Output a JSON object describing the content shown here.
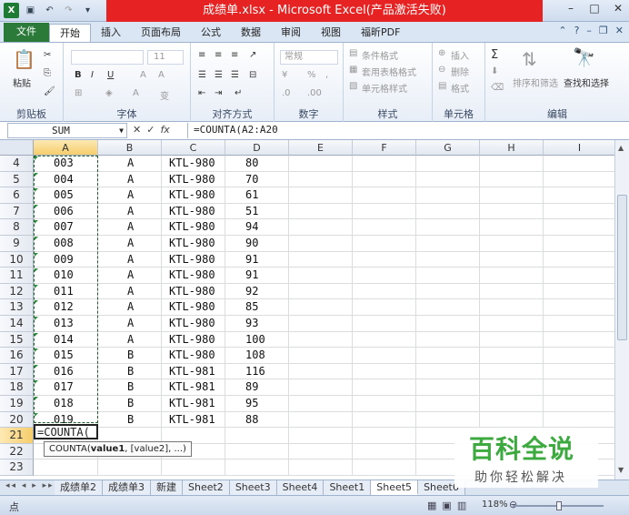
{
  "window": {
    "title": "成绩单.xlsx - Microsoft Excel(产品激活失败)",
    "quick_access_icons": [
      "excel-app-icon",
      "save-icon",
      "undo-icon",
      "redo-icon",
      "customize-icon"
    ],
    "controls": [
      "minimize",
      "maximize",
      "close"
    ]
  },
  "ribbon_tabs": [
    {
      "label": "文件"
    },
    {
      "label": "开始"
    },
    {
      "label": "插入"
    },
    {
      "label": "页面布局"
    },
    {
      "label": "公式"
    },
    {
      "label": "数据"
    },
    {
      "label": "审阅"
    },
    {
      "label": "视图"
    },
    {
      "label": "福昕PDF"
    }
  ],
  "ribbon": {
    "clipboard": {
      "label": "剪贴板",
      "paste": "粘贴"
    },
    "font": {
      "label": "字体",
      "size": "11",
      "bold": "B",
      "italic": "I",
      "underline": "U",
      "grow": "A",
      "shrink": "A",
      "color_a": "A",
      "wen": "变"
    },
    "alignment": {
      "label": "对齐方式"
    },
    "number": {
      "label": "数字",
      "format": "常规",
      "percent": "%",
      "comma": ","
    },
    "styles": {
      "label": "样式",
      "conditional": "条件格式",
      "table": "套用表格格式",
      "cell_styles": "单元格样式"
    },
    "cells": {
      "label": "单元格",
      "insert": "插入",
      "delete": "删除",
      "format": "格式"
    },
    "editing": {
      "label": "编辑",
      "sum": "Σ",
      "sort": "排序和筛选",
      "find": "查找和选择"
    }
  },
  "formula_bar": {
    "name_box": "SUM",
    "cancel": "✕",
    "enter": "✓",
    "fx": "fx",
    "formula": "=COUNTA(A2:A20"
  },
  "columns": [
    "A",
    "B",
    "C",
    "D",
    "E",
    "F",
    "G",
    "H",
    "I"
  ],
  "rows": [
    {
      "row": "4",
      "a": "003",
      "b": "A",
      "c": "KTL-980",
      "d": "80"
    },
    {
      "row": "5",
      "a": "004",
      "b": "A",
      "c": "KTL-980",
      "d": "70"
    },
    {
      "row": "6",
      "a": "005",
      "b": "A",
      "c": "KTL-980",
      "d": "61"
    },
    {
      "row": "7",
      "a": "006",
      "b": "A",
      "c": "KTL-980",
      "d": "51"
    },
    {
      "row": "8",
      "a": "007",
      "b": "A",
      "c": "KTL-980",
      "d": "94"
    },
    {
      "row": "9",
      "a": "008",
      "b": "A",
      "c": "KTL-980",
      "d": "90"
    },
    {
      "row": "10",
      "a": "009",
      "b": "A",
      "c": "KTL-980",
      "d": "91"
    },
    {
      "row": "11",
      "a": "010",
      "b": "A",
      "c": "KTL-980",
      "d": "91"
    },
    {
      "row": "12",
      "a": "011",
      "b": "A",
      "c": "KTL-980",
      "d": " 92"
    },
    {
      "row": "13",
      "a": "012",
      "b": "A",
      "c": "KTL-980",
      "d": " 85"
    },
    {
      "row": "14",
      "a": "013",
      "b": "A",
      "c": "KTL-980",
      "d": "93"
    },
    {
      "row": "15",
      "a": "014",
      "b": "A",
      "c": "KTL-980",
      "d": "100"
    },
    {
      "row": "16",
      "a": "015",
      "b": "B",
      "c": "KTL-980",
      "d": "108"
    },
    {
      "row": "17",
      "a": "016",
      "b": "B",
      "c": "KTL-981",
      "d": " 116"
    },
    {
      "row": "18",
      "a": "017",
      "b": "B",
      "c": "KTL-981",
      "d": "89"
    },
    {
      "row": "19",
      "a": "018",
      "b": "B",
      "c": "KTL-981",
      "d": "95"
    },
    {
      "row": "20",
      "a": "019",
      "b": "B",
      "c": "KTL-981",
      "d": "88"
    },
    {
      "row": "21",
      "a": "=COUNTA(",
      "b": "",
      "c": "",
      "d": ""
    },
    {
      "row": "22",
      "a": "",
      "b": "",
      "c": "",
      "d": ""
    },
    {
      "row": "23",
      "a": "",
      "b": "",
      "c": "",
      "d": ""
    }
  ],
  "editing_cell": "=COUNTA(",
  "tooltip": {
    "fn": "COUNTA(",
    "arg1": "value1",
    "rest": ", [value2], ...)"
  },
  "sheet_tabs": [
    "成绩单2",
    "成绩单3",
    "新建",
    "Sheet2",
    "Sheet3",
    "Sheet4",
    "Sheet1",
    "Sheet5",
    "Sheet6"
  ],
  "active_sheet": "Sheet5",
  "status": {
    "mode": "点",
    "zoom": "118%"
  },
  "watermark": {
    "title": "百科全说",
    "subtitle": "助你轻松解决"
  },
  "colors": {
    "title_red": "#e62222",
    "file_tab": "#2b7a3a",
    "selected_header": "#f6cd6b",
    "watermark_green": "#3daa3f"
  }
}
